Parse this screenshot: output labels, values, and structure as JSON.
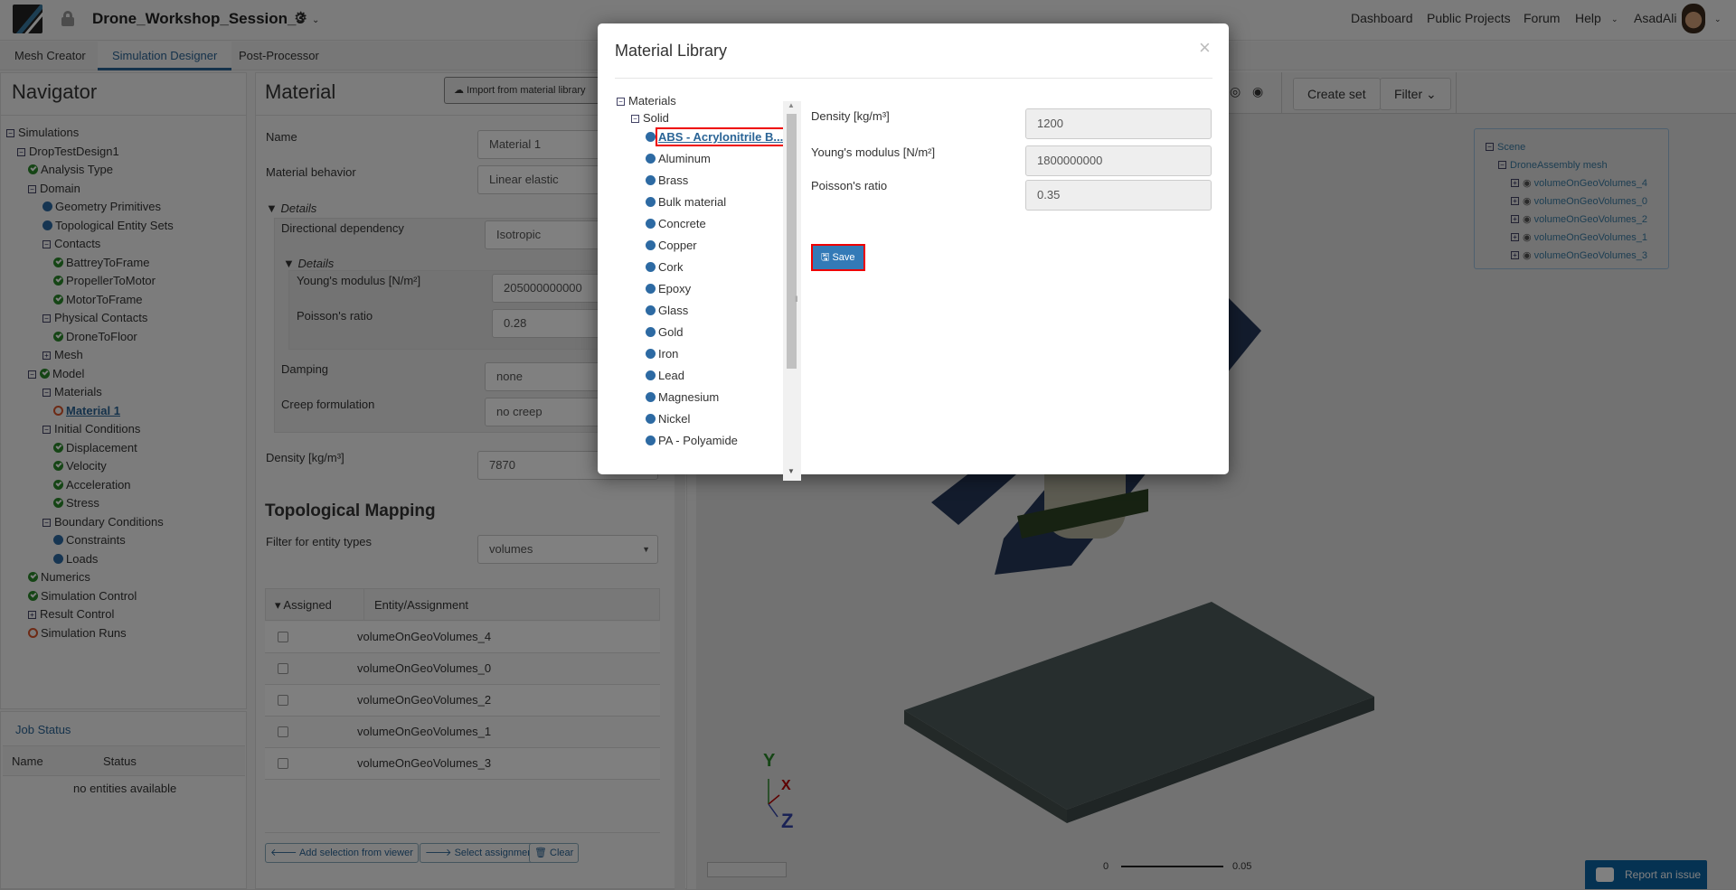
{
  "header": {
    "project_title": "Drone_Workshop_Session_3",
    "nav": [
      "Dashboard",
      "Public Projects",
      "Forum",
      "Help",
      "AsadAli"
    ]
  },
  "tabs": [
    "Mesh Creator",
    "Simulation Designer",
    "Post-Processor"
  ],
  "navigator": {
    "title": "Navigator",
    "items": [
      {
        "label": "Simulations",
        "lvl": 0,
        "icon": "minus"
      },
      {
        "label": "DropTestDesign1",
        "lvl": 1,
        "icon": "minus"
      },
      {
        "label": "Analysis Type",
        "lvl": 2,
        "icon": "ok"
      },
      {
        "label": "Domain",
        "lvl": 2,
        "icon": "minus"
      },
      {
        "label": "Geometry Primitives",
        "lvl": 3,
        "icon": "dot"
      },
      {
        "label": "Topological Entity Sets",
        "lvl": 3,
        "icon": "dot"
      },
      {
        "label": "Contacts",
        "lvl": 3,
        "icon": "minus"
      },
      {
        "label": "BattreyToFrame",
        "lvl": 4,
        "icon": "ok"
      },
      {
        "label": "PropellerToMotor",
        "lvl": 4,
        "icon": "ok"
      },
      {
        "label": "MotorToFrame",
        "lvl": 4,
        "icon": "ok"
      },
      {
        "label": "Physical Contacts",
        "lvl": 3,
        "icon": "minus"
      },
      {
        "label": "DroneToFloor",
        "lvl": 4,
        "icon": "ok"
      },
      {
        "label": "Mesh",
        "lvl": 3,
        "icon": "plus"
      },
      {
        "label": "Model",
        "lvl": 2,
        "icon": "minus-ok"
      },
      {
        "label": "Materials",
        "lvl": 3,
        "icon": "minus"
      },
      {
        "label": "Material 1",
        "lvl": 4,
        "icon": "ring",
        "link": true
      },
      {
        "label": "Initial Conditions",
        "lvl": 3,
        "icon": "minus"
      },
      {
        "label": "Displacement",
        "lvl": 4,
        "icon": "ok"
      },
      {
        "label": "Velocity",
        "lvl": 4,
        "icon": "ok"
      },
      {
        "label": "Acceleration",
        "lvl": 4,
        "icon": "ok"
      },
      {
        "label": "Stress",
        "lvl": 4,
        "icon": "ok"
      },
      {
        "label": "Boundary Conditions",
        "lvl": 3,
        "icon": "minus"
      },
      {
        "label": "Constraints",
        "lvl": 4,
        "icon": "dot"
      },
      {
        "label": "Loads",
        "lvl": 4,
        "icon": "dot"
      },
      {
        "label": "Numerics",
        "lvl": 2,
        "icon": "ok"
      },
      {
        "label": "Simulation Control",
        "lvl": 2,
        "icon": "ok"
      },
      {
        "label": "Result Control",
        "lvl": 2,
        "icon": "plus"
      },
      {
        "label": "Simulation Runs",
        "lvl": 2,
        "icon": "ring"
      }
    ]
  },
  "job_status": {
    "title": "Job Status",
    "columns": [
      "Name",
      "Status"
    ],
    "empty": "no entities available"
  },
  "material": {
    "title": "Material",
    "import_label": "Import from material library",
    "name_label": "Name",
    "name_value": "Material 1",
    "behavior_label": "Material behavior",
    "behavior_value": "Linear elastic",
    "details": "Details",
    "directional_label": "Directional dependency",
    "directional_value": "Isotropic",
    "youngs_label": "Young's modulus [N/m²]",
    "youngs_value": "205000000000",
    "poisson_label": "Poisson's ratio",
    "poisson_value": "0.28",
    "damping_label": "Damping",
    "damping_value": "none",
    "creep_label": "Creep formulation",
    "creep_value": "no creep",
    "density_label": "Density [kg/m³]",
    "density_value": "7870",
    "topo_title": "Topological Mapping",
    "filter_label": "Filter for entity types",
    "filter_value": "volumes",
    "table_headers": [
      "Assigned",
      "Entity/Assignment"
    ],
    "rows": [
      "volumeOnGeoVolumes_4",
      "volumeOnGeoVolumes_0",
      "volumeOnGeoVolumes_2",
      "volumeOnGeoVolumes_1",
      "volumeOnGeoVolumes_3"
    ],
    "add_selection": "Add selection from viewer",
    "select_assignment": "Select assignment",
    "clear": "Clear"
  },
  "viewer": {
    "create_set": "Create set",
    "filter": "Filter",
    "scene_root": "Scene",
    "scene_mesh": "DroneAssembly mesh",
    "scene_items": [
      "volumeOnGeoVolumes_4",
      "volumeOnGeoVolumes_0",
      "volumeOnGeoVolumes_2",
      "volumeOnGeoVolumes_1",
      "volumeOnGeoVolumes_3"
    ],
    "scale_min": "0",
    "scale_max": "0.05",
    "axes": [
      "Y",
      "X",
      "Z"
    ],
    "report": "Report an issue"
  },
  "modal": {
    "title": "Material Library",
    "close": "×",
    "root": "Materials",
    "group": "Solid",
    "materials": [
      "ABS - Acrylonitrile B...",
      "Aluminum",
      "Brass",
      "Bulk material",
      "Concrete",
      "Copper",
      "Cork",
      "Epoxy",
      "Glass",
      "Gold",
      "Iron",
      "Lead",
      "Magnesium",
      "Nickel",
      "PA - Polyamide"
    ],
    "density_label": "Density [kg/m³]",
    "density_value": "1200",
    "youngs_label": "Young's modulus [N/m²]",
    "youngs_value": "1800000000",
    "poisson_label": "Poisson's ratio",
    "poisson_value": "0.35",
    "save": "Save"
  }
}
